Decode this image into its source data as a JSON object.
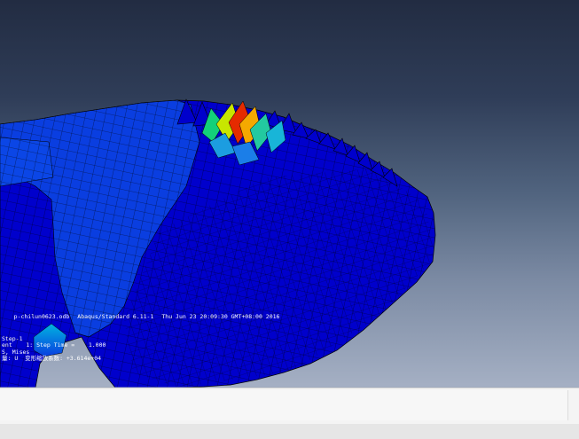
{
  "viewport": {
    "odb_info": {
      "file": "p-chilun0623.odb",
      "solver": "Abaqus/Standard 6.11-1",
      "date": "Thu Jun 23 20:09:30 GMT+08:00 2016"
    },
    "state": {
      "step_line": "Step-1",
      "increment_line": "ent    1: Step Time =    1.000",
      "var_line": "S, Mises",
      "deform_line": "量: U  变形缩放系数: +3.614e+04"
    },
    "colors": {
      "mesh_fill": "#0000cc",
      "mesh_light": "#0a3ee0",
      "mesh_lines": "#000000",
      "hot_red": "#e52b00",
      "hot_yellow": "#c8e600",
      "hot_green": "#22cc55",
      "cyan": "#00b4e0"
    }
  },
  "bottom_panel": {
    "prompt_text": ""
  }
}
